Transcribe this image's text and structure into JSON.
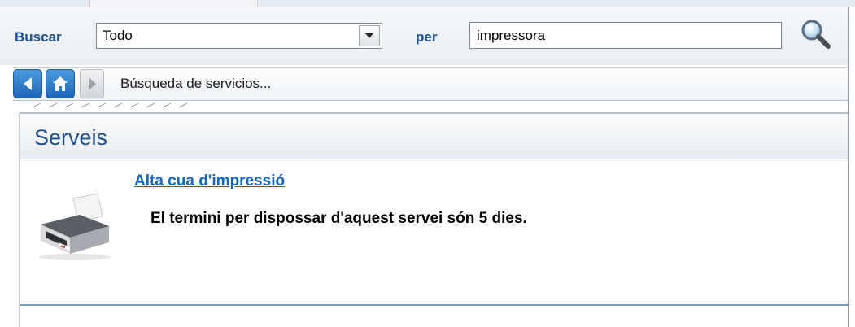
{
  "search": {
    "label": "Buscar",
    "category_value": "Todo",
    "per_label": "per",
    "query_value": "impressora"
  },
  "nav": {
    "breadcrumb": "Búsqueda de servicios..."
  },
  "panel": {
    "title": "Serveis",
    "service_link": "Alta cua d'impressió",
    "service_description": "El termini per dispossar d'aquest servei són 5 dies."
  },
  "colors": {
    "accent": "#1b4f90",
    "link": "#1565b8",
    "nav_button": "#1e66b6"
  },
  "icons": [
    "search-icon",
    "back-arrow-icon",
    "home-icon",
    "forward-arrow-icon",
    "chevron-down-icon",
    "printer-icon"
  ]
}
